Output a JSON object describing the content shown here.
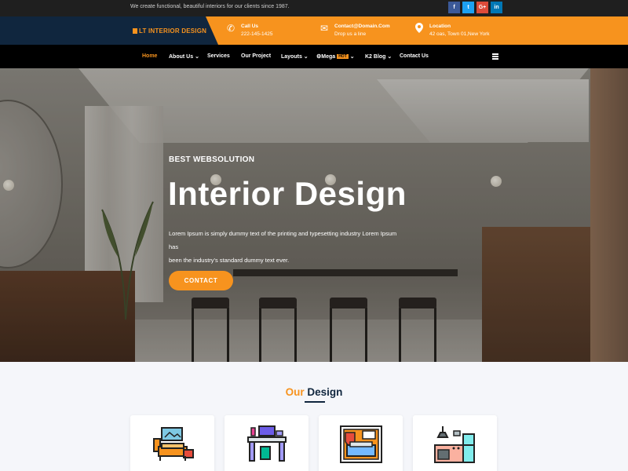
{
  "topbar": {
    "tagline": "We create functional, beautiful interiors for our clients since 1987.",
    "social": [
      {
        "icon": "facebook-icon",
        "glyph": "f",
        "color": "#3b5998"
      },
      {
        "icon": "twitter-icon",
        "glyph": "t",
        "color": "#1da1f2"
      },
      {
        "icon": "google-plus-icon",
        "glyph": "G+",
        "color": "#dd4b39"
      },
      {
        "icon": "linkedin-icon",
        "glyph": "in",
        "color": "#0077b5"
      }
    ]
  },
  "brand": {
    "logo": "LT INTERIOR DESIGN",
    "accent": "#f7931e",
    "dark": "#10263e"
  },
  "info": {
    "call": {
      "icon": "phone-icon",
      "title": "Call Us",
      "value": "222-145-1425"
    },
    "mail": {
      "icon": "mail-icon",
      "title": "Contact@Domain.Com",
      "value": "Drop us a line"
    },
    "location": {
      "icon": "location-pin-icon",
      "title": "Location",
      "value": "42 oas, Town 01,New York"
    }
  },
  "nav": {
    "home": "Home",
    "about": "About Us",
    "services": "Services",
    "project": "Our Project",
    "layouts": "Layouts",
    "mega": "Mega",
    "mega_badge": "HOT",
    "k2blog": "K2 Blog",
    "contact": "Contact Us"
  },
  "hero": {
    "subtitle": "BEST WEBSOLUTION",
    "title": "Interior Design",
    "text_line1": "Lorem Ipsum is simply dummy text of the printing and typesetting industry Lorem Ipsum has",
    "text_line2": "been the industry's standard dummy text ever.",
    "button": "CONTACT"
  },
  "section": {
    "title_accent": "Our",
    "title_main": "Design",
    "cards": [
      {
        "icon": "living-room-icon"
      },
      {
        "icon": "workspace-desk-icon"
      },
      {
        "icon": "bedroom-icon"
      },
      {
        "icon": "kitchen-icon"
      }
    ]
  }
}
